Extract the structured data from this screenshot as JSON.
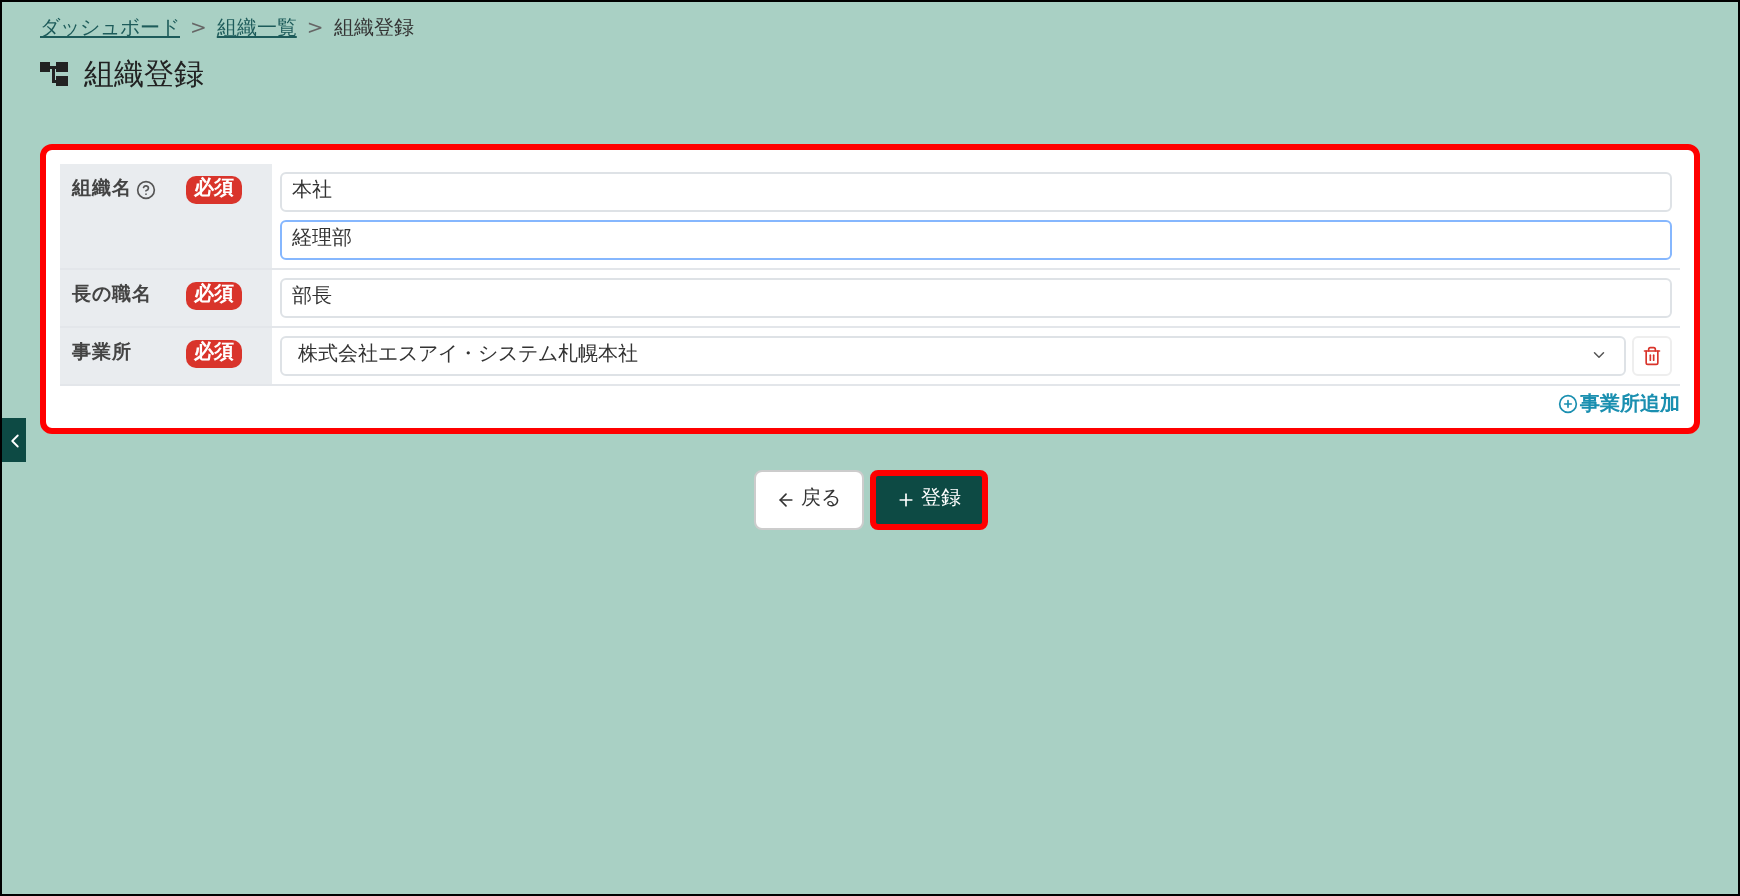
{
  "breadcrumb": [
    {
      "label": "ダッシュボード",
      "link": true
    },
    {
      "label": "組織一覧",
      "link": true
    },
    {
      "label": "組織登録",
      "link": false
    }
  ],
  "breadcrumb_separator": ">",
  "page_title": "組織登録",
  "form": {
    "highlighted": true,
    "rows": [
      {
        "label": "組織名",
        "help": true,
        "badge": "必須",
        "kind": "inputs",
        "fields": [
          {
            "value": "本社",
            "focused": false
          },
          {
            "value": "経理部",
            "focused": true
          }
        ]
      },
      {
        "label": "長の職名",
        "help": false,
        "badge": "必須",
        "kind": "inputs",
        "fields": [
          {
            "value": "部長",
            "focused": false
          }
        ]
      },
      {
        "label": "事業所",
        "help": false,
        "badge": "必須",
        "kind": "select",
        "value": "株式会社エスアイ・システム札幌本社"
      }
    ],
    "add_link": "事業所追加"
  },
  "buttons": [
    {
      "label": "戻る",
      "kind": "back",
      "highlighted": false
    },
    {
      "label": "登録",
      "kind": "submit",
      "highlighted": true
    }
  ]
}
